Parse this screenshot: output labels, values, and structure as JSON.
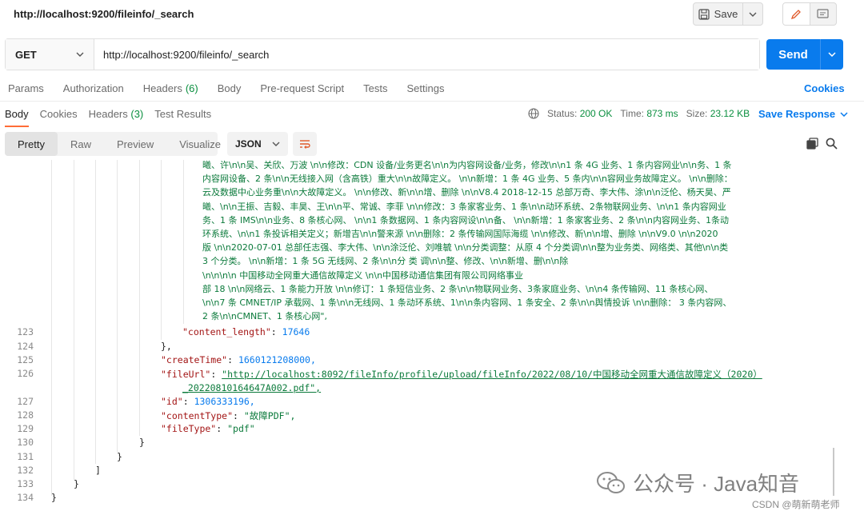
{
  "request": {
    "title": "http://localhost:9200/fileinfo/_search",
    "method": "GET",
    "url": "http://localhost:9200/fileinfo/_search",
    "save_label": "Save",
    "send_label": "Send"
  },
  "request_tabs": {
    "params": "Params",
    "authorization": "Authorization",
    "headers": "Headers",
    "headers_count": "(6)",
    "body": "Body",
    "prerequest": "Pre-request Script",
    "tests": "Tests",
    "settings": "Settings",
    "cookies": "Cookies"
  },
  "response_tabs": {
    "body": "Body",
    "cookies": "Cookies",
    "headers": "Headers",
    "headers_count": "(3)",
    "test_results": "Test Results",
    "status_label": "Status:",
    "status_value": "200 OK",
    "time_label": "Time:",
    "time_value": "873 ms",
    "size_label": "Size:",
    "size_value": "23.12 KB",
    "save_response": "Save Response"
  },
  "view": {
    "pretty": "Pretty",
    "raw": "Raw",
    "preview": "Preview",
    "visualize": "Visualize",
    "format": "JSON"
  },
  "code": {
    "wrapped_lines": [
      "曦、许\\n\\n吴、关欣、万波 \\n\\n修改：CDN 设备/业务更名\\n\\n为内容网设备/业务，修改\\n\\n1 条 4G 业务、1 条内容网业\\n\\n务、1 条",
      "内容网设备、2 条\\n\\n无线接入网（含高铁）重大\\n\\n故障定义。 \\n\\n新增：1 条 4G 业务、5 条内\\n\\n容网业务故障定义。 \\n\\n删除：",
      "云及数据中心业务重\\n\\n大故障定义。 \\n\\n修改、新\\n\\n增、删除 \\n\\nV8.4 2018-12-15 总部万奇、李大伟、涂\\n\\n泛伦、杨天昊、严",
      "曦、\\n\\n王振、吉毅、丰昊、王\\n\\n平、常诚、李菲 \\n\\n修改：3 条家客业务、1 条\\n\\n动环系统、2条物联网业务、\\n\\n1 条内容网业",
      "务、1 条 IMS\\n\\n业务、8 条核心网、 \\n\\n1 条数据网、1 条内容网设\\n\\n备、 \\n\\n新增：1 条家客业务、2 条\\n\\n内容网业务、1条动",
      "环系统、\\n\\n1 条投诉相关定义；新增吉\\n\\n警来源 \\n\\n删除：2 条传输网国际海缆 \\n\\n修改、新\\n\\n增、删除 \\n\\nV9.0 \\n\\n2020",
      "版 \\n\\n2020-07-01 总部任志强、李大伟、\\n\\n涂泛伦、刘唯毓 \\n\\n分类调整：从原 4 个分类调\\n\\n整为业务类、网络类、其他\\n\\n类",
      "3 个分类。 \\n\\n新增：1 条 5G 无线网、2 条\\n\\n分 类 调\\n\\n整、修改、\\n\\n新增、删\\n\\n除",
      "\\n\\n\\n\\n                        中国移动全网重大通信故障定义 \\n\\n中国移动通信集团有限公司网络事业",
      "部 18 \\n\\n网络云、1 条能力开放 \\n\\n修订：1 条短信业务、2 条\\n\\n物联网业务、3条家庭业务、\\n\\n4 条传输网、11 条核心网、",
      "\\n\\n7 条 CMNET/IP 承载网、1 条\\n\\n无线网、1 条动环系统、1\\n\\n条内容网、1 条安全、2 条\\n\\n舆情投诉 \\n\\n删除： 3 条内容网、",
      "2 条\\n\\nCMNET、1 条核心网\","
    ],
    "content_length_key": "\"content_length\"",
    "content_length_val": "17646",
    "createTime_key": "\"createTime\"",
    "createTime_val": "1660121208000,",
    "fileUrl_key": "\"fileUrl\"",
    "fileUrl_val_1": "\"http://localhost:8092/fileInfo/profile/upload/fileInfo/2022/08/10/中国移动全网重大通信故障定义（2020）",
    "fileUrl_val_2": "_20220810164647A002.pdf\",",
    "id_key": "\"id\"",
    "id_val": "1306333196,",
    "contentType_key": "\"contentType\"",
    "contentType_val": "\"故障PDF\",",
    "fileType_key": "\"fileType\"",
    "fileType_val": "\"pdf\"",
    "line_numbers": [
      "123",
      "124",
      "125",
      "126",
      "127",
      "128",
      "129",
      "130",
      "131",
      "132",
      "133",
      "134"
    ]
  },
  "watermark": {
    "text": "公众号 · Java知音",
    "csdn": "CSDN @萌新萌老师"
  }
}
